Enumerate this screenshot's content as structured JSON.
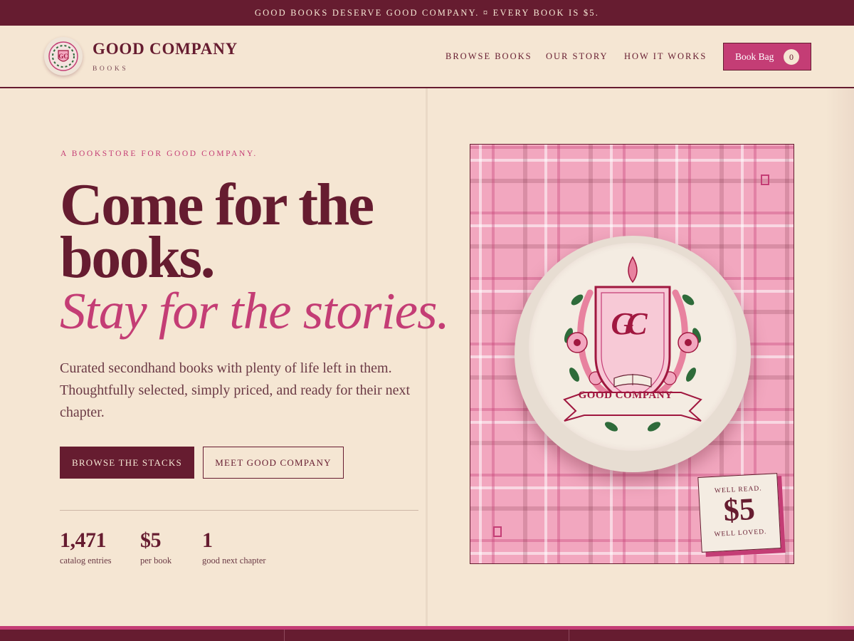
{
  "announcement": "GOOD BOOKS DESERVE GOOD COMPANY. ¤ EVERY BOOK IS $5.",
  "brand": {
    "name": "GOOD COMPANY",
    "sub": "BOOKS",
    "monogram": "GC"
  },
  "nav": [
    "BROWSE BOOKS",
    "OUR STORY",
    "HOW IT WORKS"
  ],
  "bag": {
    "label": "Book Bag",
    "count": "0"
  },
  "hero": {
    "eyebrow": "A BOOKSTORE FOR GOOD COMPANY.",
    "title_line1": "Come for the",
    "title_line2": "books.",
    "subtitle": "Stay for the stories.",
    "description": "Curated secondhand books with plenty of life left in them. Thoughtfully selected, simply priced, and ready for their next chapter.",
    "primary_button": "BROWSE THE STACKS",
    "secondary_button": "MEET GOOD COMPANY"
  },
  "stats": [
    {
      "value": "1,471",
      "label": "catalog entries"
    },
    {
      "value": "$5",
      "label": "per book"
    },
    {
      "value": "1",
      "label": "good next chapter"
    }
  ],
  "art": {
    "crest_monogram": "GC",
    "ribbon_text": "GOOD COMPANY",
    "price_card": {
      "top": "WELL READ.",
      "price": "$5",
      "bottom": "WELL LOVED."
    }
  },
  "colors": {
    "wine": "#661c30",
    "pink": "#c43d75",
    "cream": "#f5e6d3",
    "plaid": "#f2a7bf"
  }
}
